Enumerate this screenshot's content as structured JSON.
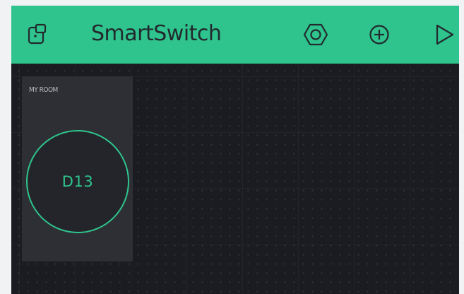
{
  "app": {
    "title": "SmartSwitch"
  },
  "header": {
    "icons": {
      "left": "device-icon",
      "settings": "settings-hexagon-icon",
      "add": "add-widget-icon",
      "play": "play-icon"
    }
  },
  "widgets": [
    {
      "type": "button",
      "label": "MY ROOM",
      "pin": "D13"
    }
  ],
  "colors": {
    "accent": "#2fc48d",
    "background": "#1b1c22",
    "widget": "#2d2f34",
    "header_text": "#222a2e"
  }
}
